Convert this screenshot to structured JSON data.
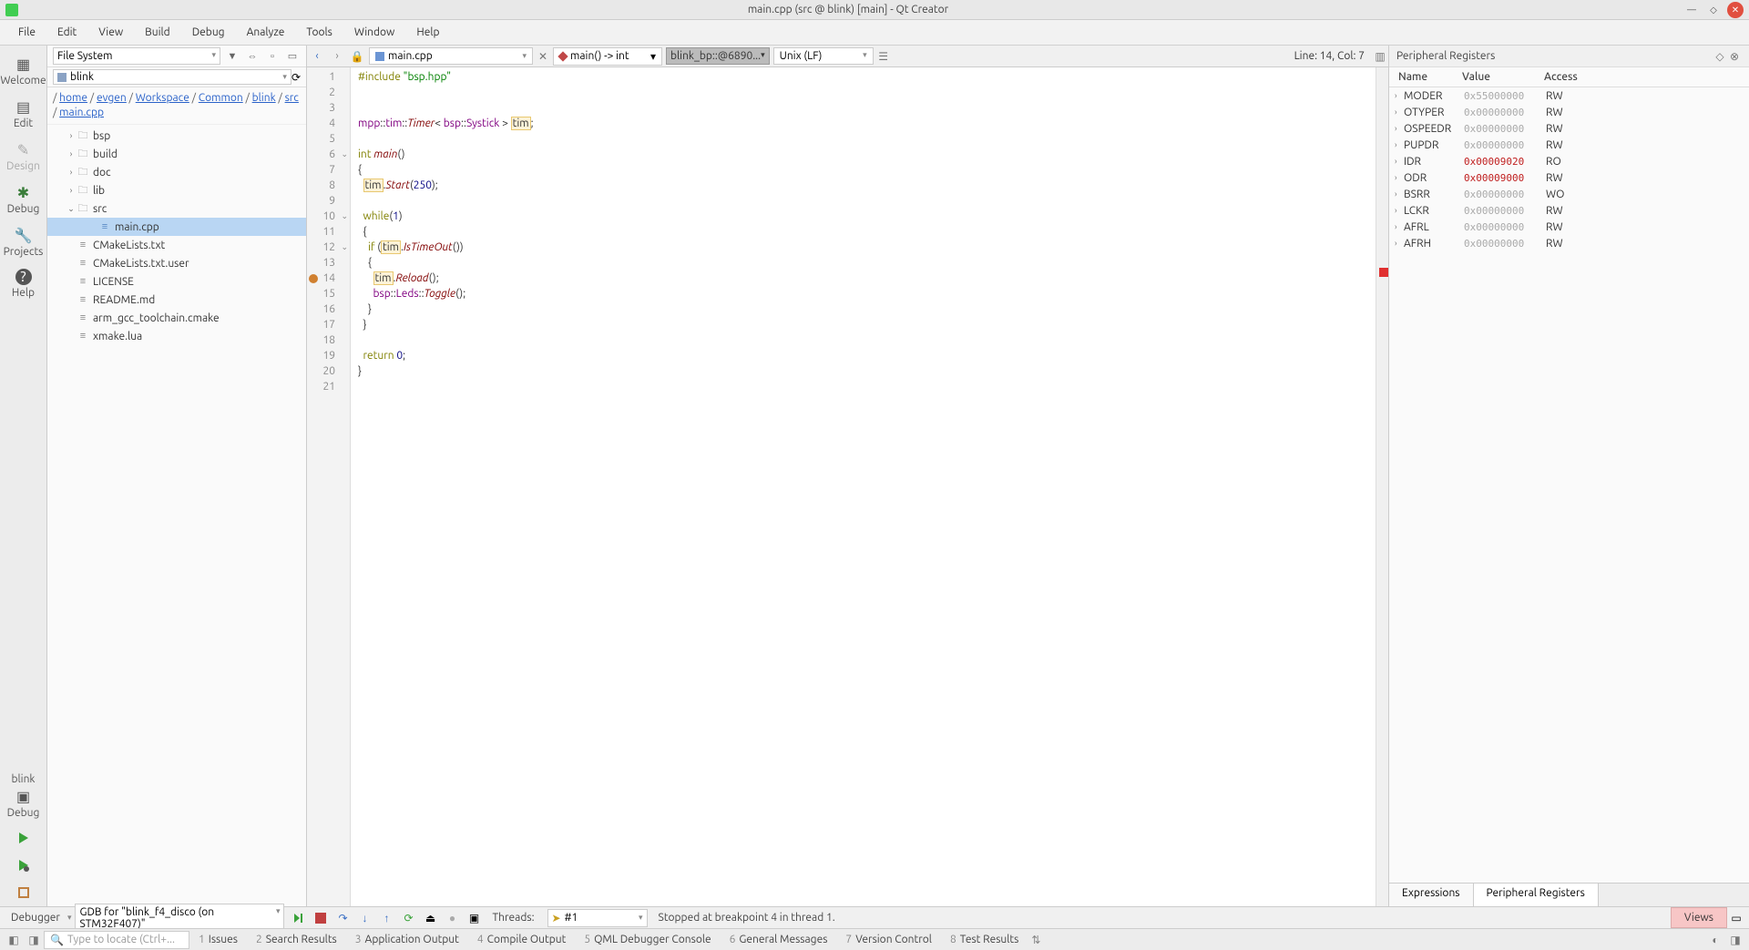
{
  "titlebar": {
    "title": "main.cpp (src @ blink) [main] - Qt Creator"
  },
  "menu": [
    "File",
    "Edit",
    "View",
    "Build",
    "Debug",
    "Analyze",
    "Tools",
    "Window",
    "Help"
  ],
  "modebar": {
    "items": [
      {
        "label": "Welcome"
      },
      {
        "label": "Edit"
      },
      {
        "label": "Design"
      },
      {
        "label": "Debug"
      },
      {
        "label": "Projects"
      },
      {
        "label": "Help"
      }
    ],
    "bottom": {
      "project": "blink",
      "config": "Debug"
    }
  },
  "fs": {
    "selector": "File System",
    "project": "blink",
    "breadcrumb": [
      "home",
      "evgen",
      "Workspace",
      "Common",
      "blink",
      "src",
      "main.cpp"
    ],
    "tree": [
      {
        "name": "bsp",
        "folder": true,
        "arrow": ">"
      },
      {
        "name": "build",
        "folder": true,
        "arrow": ">"
      },
      {
        "name": "doc",
        "folder": true,
        "arrow": ">"
      },
      {
        "name": "lib",
        "folder": true,
        "arrow": ">"
      },
      {
        "name": "src",
        "folder": true,
        "arrow": "v",
        "children": [
          {
            "name": "main.cpp",
            "selected": true
          }
        ]
      },
      {
        "name": "CMakeLists.txt",
        "file": true
      },
      {
        "name": "CMakeLists.txt.user",
        "file": true
      },
      {
        "name": "LICENSE",
        "file": true
      },
      {
        "name": "README.md",
        "file": true
      },
      {
        "name": "arm_gcc_toolchain.cmake",
        "file": true
      },
      {
        "name": "xmake.lua",
        "file": true
      }
    ]
  },
  "editor": {
    "file": "main.cpp",
    "func": "main() -> int",
    "bp": "blink_bp::@6890...",
    "enc": "Unix (LF)",
    "linecol": "Line: 14, Col: 7",
    "code": [
      {
        "n": 1,
        "html": "<span class='kw'>#include</span> <span class='str'>\"bsp.hpp\"</span>"
      },
      {
        "n": 2,
        "html": ""
      },
      {
        "n": 3,
        "html": ""
      },
      {
        "n": 4,
        "html": "<span class='ns'>mpp</span>::<span class='ns'>tim</span>::<span class='fn'>Timer</span>&lt; <span class='ns'>bsp</span>::<span class='ns'>Systick</span> &gt; <span class='hl'>tim</span>;"
      },
      {
        "n": 5,
        "html": ""
      },
      {
        "n": 6,
        "html": "<span class='kw'>int</span> <span class='fn'>main</span>()",
        "fold": true
      },
      {
        "n": 7,
        "html": "{"
      },
      {
        "n": 8,
        "html": "  <span class='hl'>tim</span>.<span class='fn'>Start</span>(<span class='num'>250</span>);"
      },
      {
        "n": 9,
        "html": ""
      },
      {
        "n": 10,
        "html": "  <span class='kw'>while</span>(<span class='num'>1</span>)",
        "fold": true
      },
      {
        "n": 11,
        "html": "  {"
      },
      {
        "n": 12,
        "html": "    <span class='kw'>if</span> (<span class='hl'>tim</span>.<span class='fn'>IsTimeOut</span>())",
        "fold": true
      },
      {
        "n": 13,
        "html": "    {"
      },
      {
        "n": 14,
        "html": "      <span class='hl'>tim</span>.<span class='fn'>Reload</span>();",
        "bp": true
      },
      {
        "n": 15,
        "html": "      <span class='ns'>bsp</span>::<span class='ns'>Leds</span>::<span class='fn'>Toggle</span>();"
      },
      {
        "n": 16,
        "html": "    }"
      },
      {
        "n": 17,
        "html": "  }"
      },
      {
        "n": 18,
        "html": ""
      },
      {
        "n": 19,
        "html": "  <span class='kw'>return</span> <span class='num'>0</span>;"
      },
      {
        "n": 20,
        "html": "}"
      },
      {
        "n": 21,
        "html": ""
      }
    ]
  },
  "regs": {
    "title": "Peripheral Registers",
    "cols": [
      "Name",
      "Value",
      "Access"
    ],
    "rows": [
      {
        "n": "MODER",
        "v": "0x55000000",
        "a": "RW"
      },
      {
        "n": "OTYPER",
        "v": "0x00000000",
        "a": "RW"
      },
      {
        "n": "OSPEEDR",
        "v": "0x00000000",
        "a": "RW"
      },
      {
        "n": "PUPDR",
        "v": "0x00000000",
        "a": "RW"
      },
      {
        "n": "IDR",
        "v": "0x00009020",
        "a": "RO",
        "red": true
      },
      {
        "n": "ODR",
        "v": "0x00009000",
        "a": "RW",
        "red": true
      },
      {
        "n": "BSRR",
        "v": "0x00000000",
        "a": "WO"
      },
      {
        "n": "LCKR",
        "v": "0x00000000",
        "a": "RW"
      },
      {
        "n": "AFRL",
        "v": "0x00000000",
        "a": "RW"
      },
      {
        "n": "AFRH",
        "v": "0x00000000",
        "a": "RW"
      }
    ],
    "tabs": [
      "Expressions",
      "Peripheral Registers"
    ]
  },
  "dbgbar": {
    "label": "Debugger",
    "conf": "GDB for \"blink_f4_disco (on STM32F407)\"",
    "threads_label": "Threads:",
    "thread": "#1",
    "status": "Stopped at breakpoint 4 in thread 1.",
    "views": "Views"
  },
  "botbar": {
    "search_placeholder": "Type to locate (Ctrl+...",
    "panes": [
      {
        "n": "1",
        "t": "Issues"
      },
      {
        "n": "2",
        "t": "Search Results"
      },
      {
        "n": "3",
        "t": "Application Output"
      },
      {
        "n": "4",
        "t": "Compile Output"
      },
      {
        "n": "5",
        "t": "QML Debugger Console"
      },
      {
        "n": "6",
        "t": "General Messages"
      },
      {
        "n": "7",
        "t": "Version Control"
      },
      {
        "n": "8",
        "t": "Test Results"
      }
    ]
  }
}
